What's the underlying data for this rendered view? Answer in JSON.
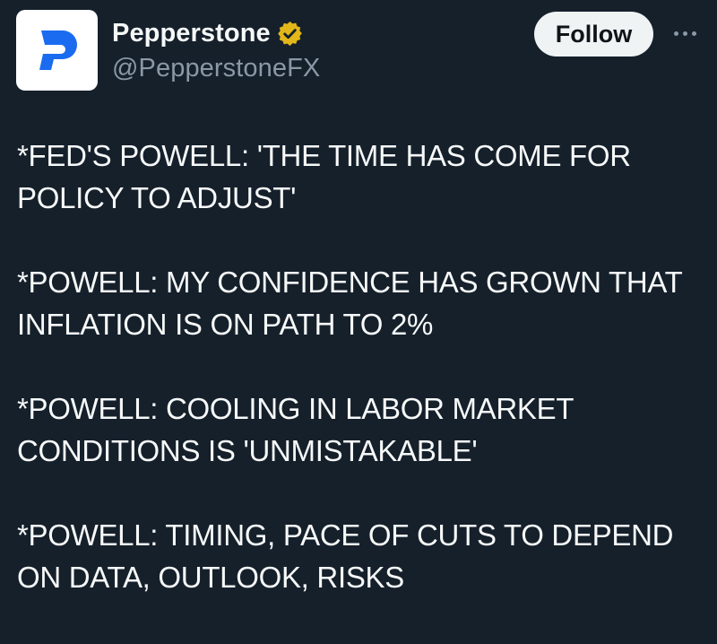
{
  "author": {
    "display_name": "Pepperstone",
    "handle": "@PepperstoneFX",
    "verified": true,
    "verified_badge_color": "#e2b719",
    "logo_letter": "P",
    "logo_color": "#1a6bf0",
    "avatar_bg": "#ffffff"
  },
  "actions": {
    "follow_label": "Follow",
    "more_icon": "more-horizontal-icon"
  },
  "tweet": {
    "paragraphs": [
      "*FED'S POWELL: 'THE TIME HAS COME FOR\nPOLICY TO ADJUST'",
      "*POWELL: MY CONFIDENCE HAS GROWN THAT\nINFLATION IS ON PATH TO 2%",
      "*POWELL: COOLING IN LABOR MARKET\nCONDITIONS IS 'UNMISTAKABLE'",
      "*POWELL: TIMING, PACE OF CUTS TO DEPEND\nON DATA, OUTLOOK, RISKS"
    ]
  },
  "theme": {
    "background": "#15202b",
    "text_primary": "#f7f9f9",
    "text_secondary": "#8b98a5"
  }
}
